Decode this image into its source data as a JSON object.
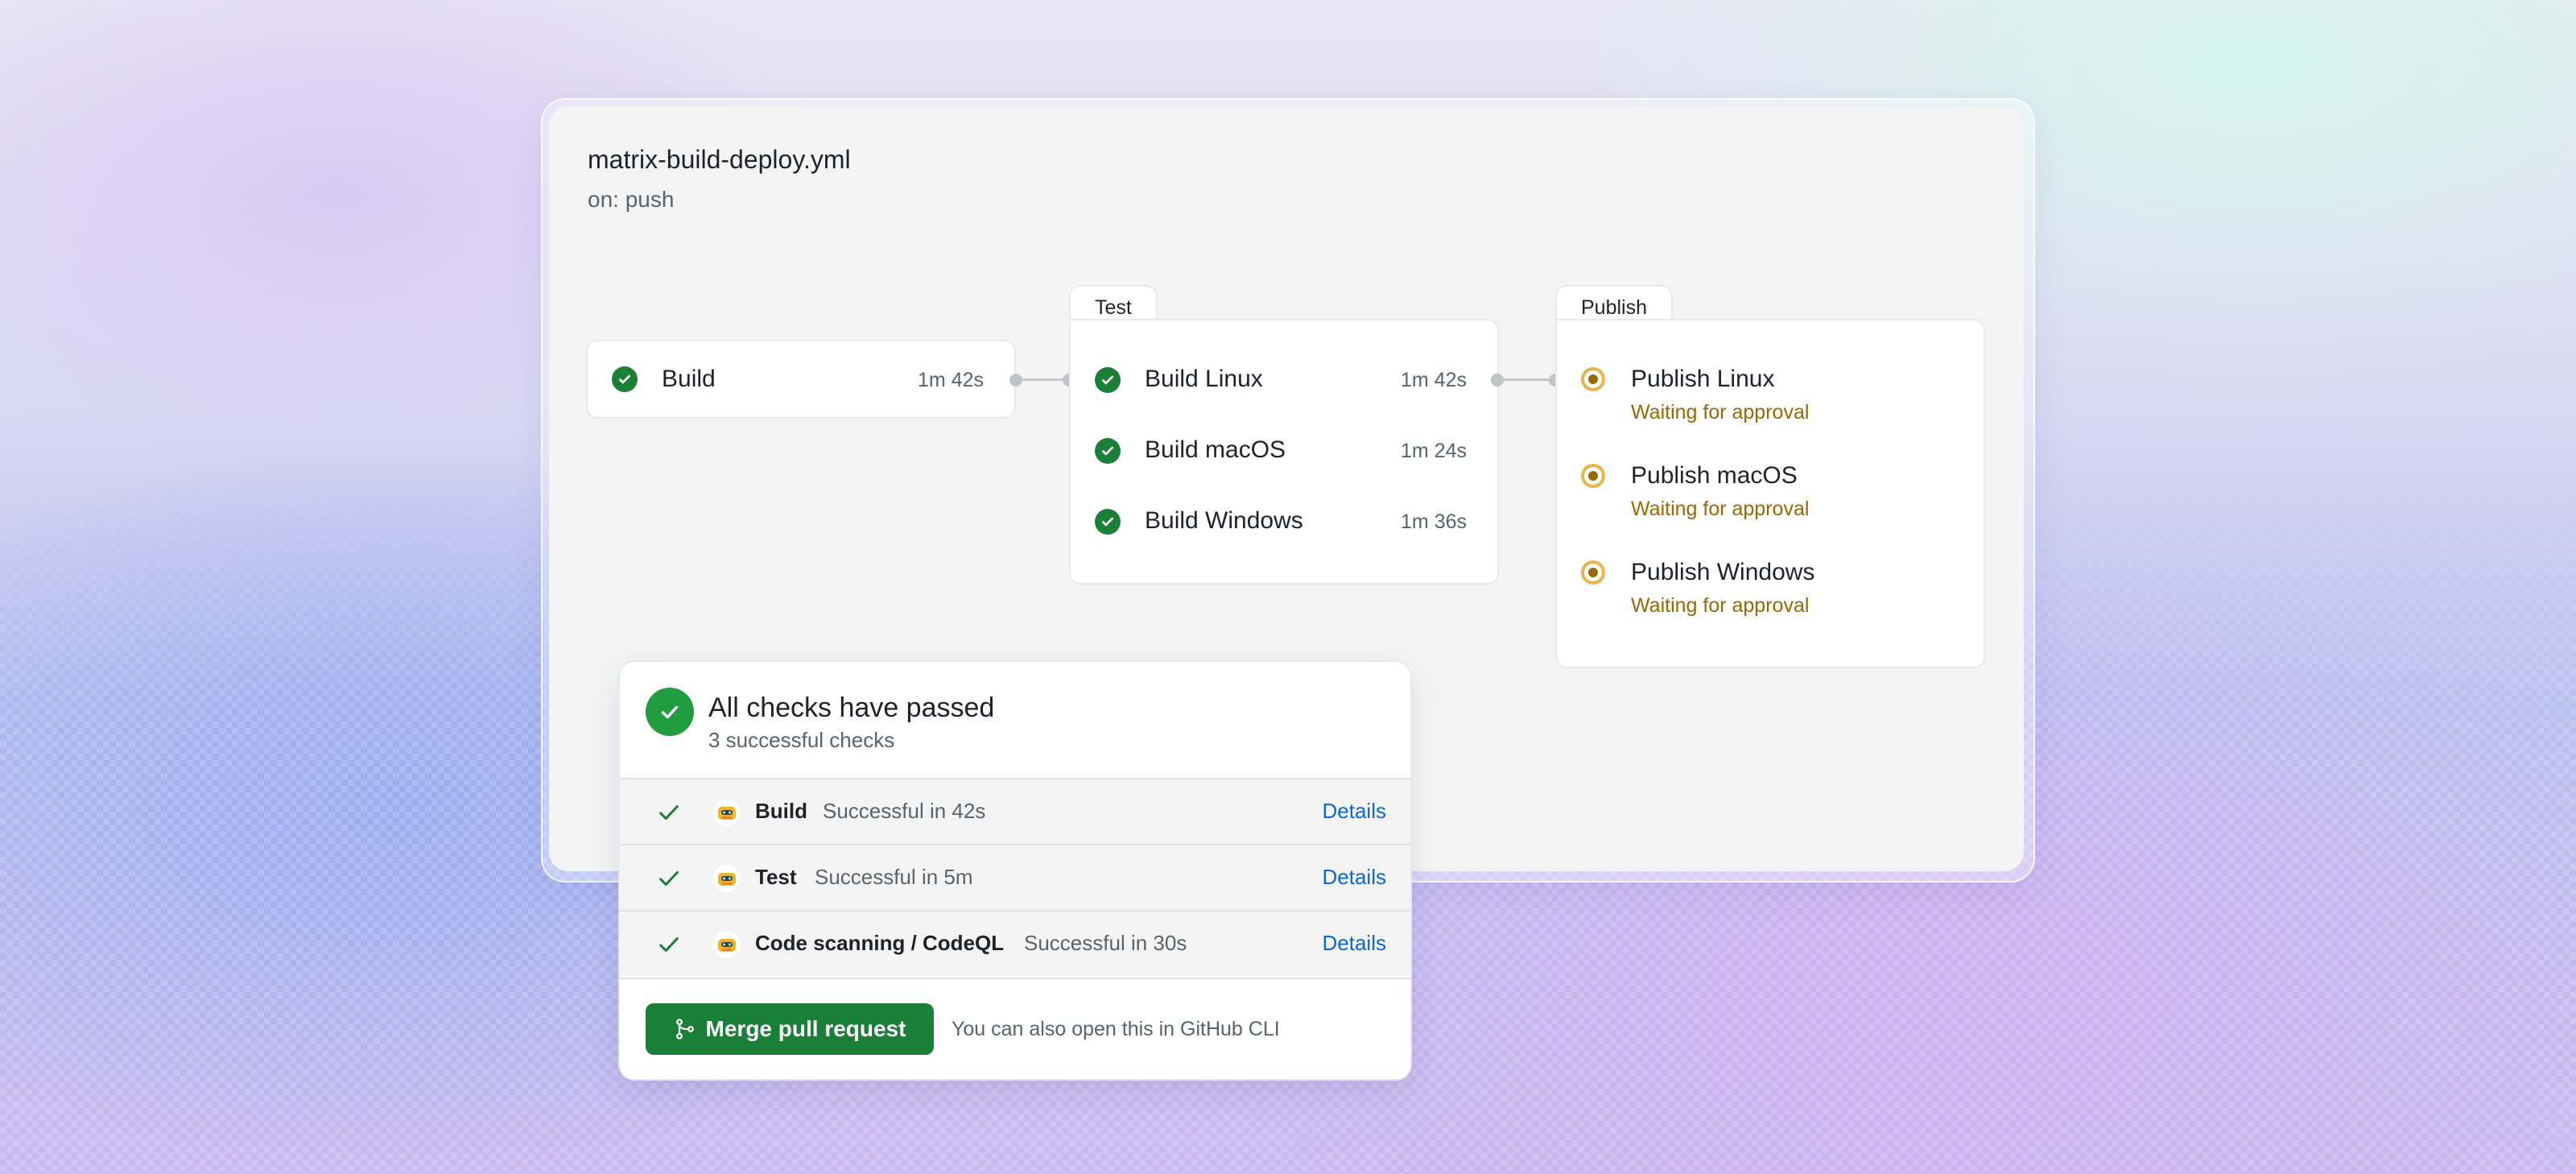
{
  "workflow": {
    "file_name": "matrix-build-deploy.yml",
    "trigger": "on: push"
  },
  "jobs": {
    "build": {
      "name": "Build",
      "duration": "1m 42s",
      "status": "success"
    },
    "test_group": {
      "label": "Test",
      "items": [
        {
          "name": "Build Linux",
          "duration": "1m 42s",
          "status": "success"
        },
        {
          "name": "Build macOS",
          "duration": "1m 24s",
          "status": "success"
        },
        {
          "name": "Build Windows",
          "duration": "1m 36s",
          "status": "success"
        }
      ]
    },
    "publish_group": {
      "label": "Publish",
      "items": [
        {
          "name": "Publish Linux",
          "status_text": "Waiting for approval"
        },
        {
          "name": "Publish macOS",
          "status_text": "Waiting for approval"
        },
        {
          "name": "Publish Windows",
          "status_text": "Waiting for approval"
        }
      ]
    }
  },
  "checks": {
    "title": "All checks have passed",
    "subtitle": "3 successful checks",
    "rows": [
      {
        "name": "Build",
        "status": "Successful in 42s",
        "link": "Details"
      },
      {
        "name": "Test",
        "status": "Successful in 5m",
        "link": "Details"
      },
      {
        "name": "Code scanning / CodeQL",
        "status": "Successful in 30s",
        "link": "Details"
      }
    ],
    "merge_button": "Merge pull request",
    "footer_note": "You can also open this in GitHub CLI"
  },
  "icons": {
    "success": "check-circle-fill-icon",
    "waiting": "waiting-icon",
    "avatar": "actions-bot-avatar-icon",
    "merge": "git-merge-icon"
  },
  "colors": {
    "success": "#1a7f37",
    "waiting": "#9a6700",
    "link": "#0969da"
  }
}
